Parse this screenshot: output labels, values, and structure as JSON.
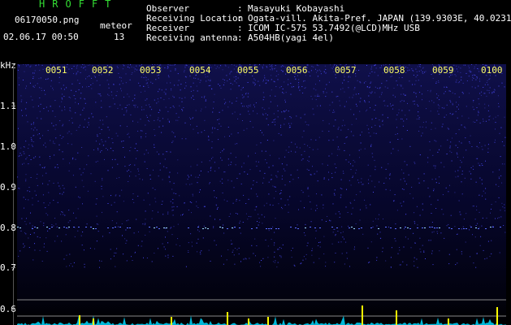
{
  "app_title": "HROFFT",
  "file": {
    "name": "06170050.png",
    "datetime": "02.06.17 00:50"
  },
  "meteor": {
    "label": "meteor",
    "count": "13"
  },
  "info": [
    {
      "label": "Observer",
      "value": "Masayuki Kobayashi"
    },
    {
      "label": "Receiving Location",
      "value": "Ogata-vill. Akita-Pref. JAPAN (139.9303E, 40.0231N)"
    },
    {
      "label": "Receiver",
      "value": "ICOM IC-575 53.7492(@LCD)MHz USB"
    },
    {
      "label": "Receiving antenna",
      "value": "A504HB(yagi 4el)"
    }
  ],
  "y_axis": {
    "unit": "kHz",
    "ticks": [
      "1.1",
      "1.0",
      "0.9",
      "0.8",
      "0.7",
      "0.6"
    ]
  },
  "x_axis": {
    "ticks": [
      "0051",
      "0052",
      "0053",
      "0054",
      "0055",
      "0056",
      "0057",
      "0058",
      "0059",
      "0100"
    ]
  },
  "colors": {
    "title": "#33dd33",
    "xticks": "#ffff66",
    "noise": "#3a3aff",
    "signal": "#00e0ff",
    "spike": "#ffff00"
  }
}
